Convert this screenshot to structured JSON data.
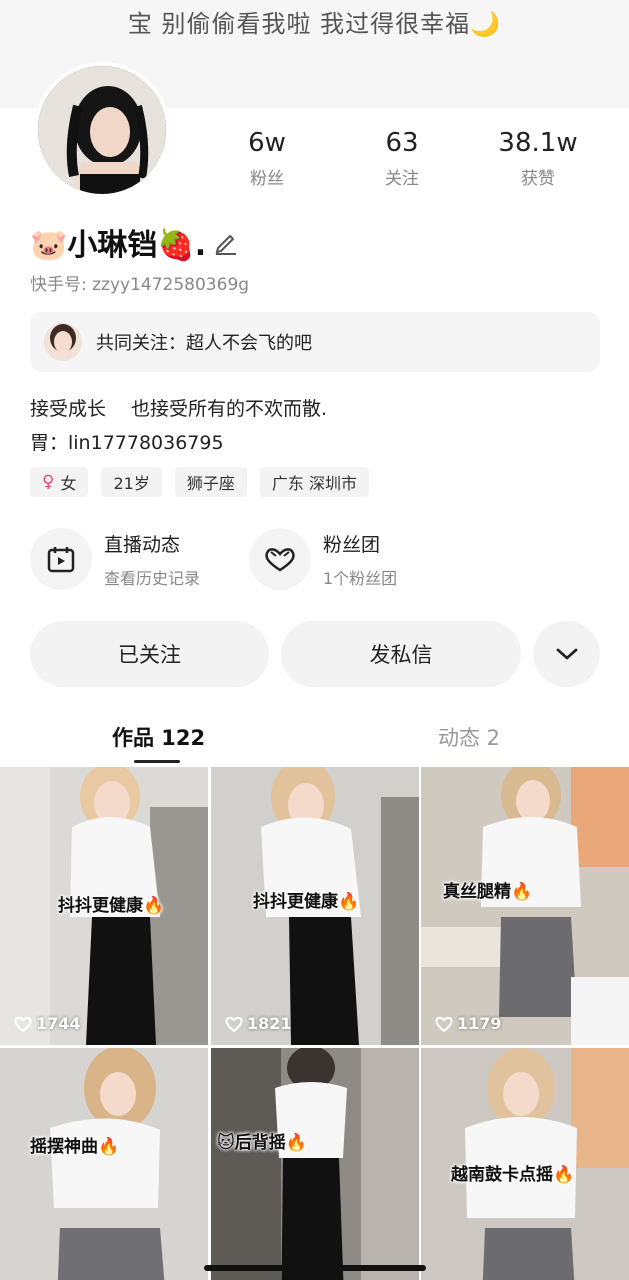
{
  "header": {
    "signature_top": "宝 别偷偷看我啦 我过得很幸福🌙"
  },
  "profile": {
    "nickname": "🐷小琳铛🍓.",
    "user_id": "快手号: zzyy1472580369g",
    "stats": [
      {
        "value": "6w",
        "label": "粉丝"
      },
      {
        "value": "63",
        "label": "关注"
      },
      {
        "value": "38.1w",
        "label": "获赞"
      }
    ],
    "mutual_follow": "共同关注：超人不会飞的吧",
    "bio_line1": "接受成长　 也接受所有的不欢而散.",
    "bio_line2": "胃：lin17778036795",
    "tags": {
      "gender": "女",
      "gender_icon": "♀",
      "age": "21岁",
      "zodiac": "狮子座",
      "location": "广东 深圳市"
    }
  },
  "entries": {
    "live": {
      "title": "直播动态",
      "subtitle": "查看历史记录",
      "icon": "calendar-play-icon"
    },
    "fans": {
      "title": "粉丝团",
      "subtitle": "1个粉丝团",
      "icon": "heart-badge-icon"
    }
  },
  "actions": {
    "follow_label": "已关注",
    "message_label": "发私信",
    "more_icon": "chevron-down-icon"
  },
  "tabs": {
    "works": "作品 122",
    "moments": "动态 2"
  },
  "works": [
    {
      "caption": "抖抖更健康🔥",
      "likes": "1744",
      "bg": "#d9d7d3"
    },
    {
      "caption": "抖抖更健康🔥",
      "likes": "1821",
      "bg": "#cfcdca"
    },
    {
      "caption": "真丝腿精🔥",
      "likes": "1179",
      "bg": "#c9c3b9"
    },
    {
      "caption": "摇摆神曲🔥",
      "bg": "#d3d1ce"
    },
    {
      "caption": "🐱后背摇🔥",
      "bg": "#8e8a86"
    },
    {
      "caption": "越南鼓卡点摇🔥",
      "bg": "#cbc7c1"
    }
  ],
  "colors": {
    "accent_gender": "#e64a80",
    "chip_bg": "#f3f3f3"
  }
}
